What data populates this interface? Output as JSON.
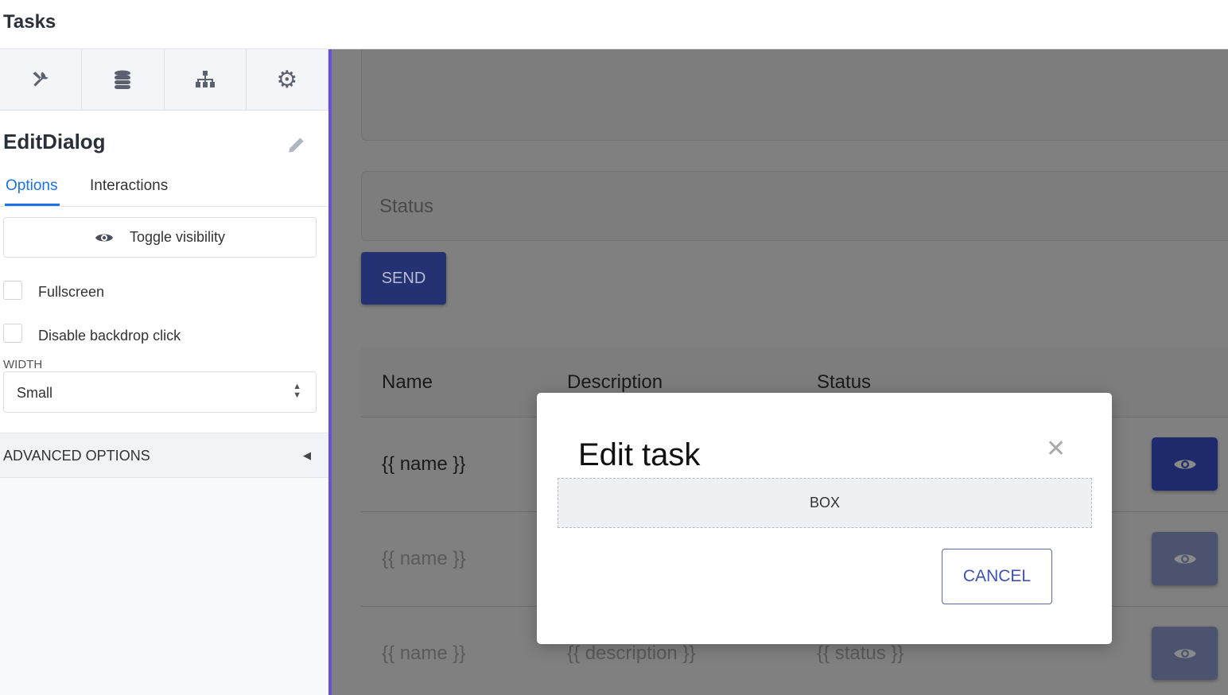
{
  "header": {
    "title": "Tasks"
  },
  "sidebar": {
    "toolbar": [
      {
        "icon": "tools-icon"
      },
      {
        "icon": "database-icon"
      },
      {
        "icon": "sitemap-icon"
      },
      {
        "icon": "gear-icon"
      }
    ],
    "component_name": "EditDialog",
    "tabs": [
      {
        "label": "Options",
        "active": true
      },
      {
        "label": "Interactions",
        "active": false
      }
    ],
    "toggle_visibility": "Toggle visibility",
    "fullscreen": {
      "label": "Fullscreen",
      "checked": false
    },
    "disable_backdrop": {
      "label": "Disable backdrop click",
      "checked": false
    },
    "width_label": "WIDTH",
    "width_value": "Small",
    "advanced": "ADVANCED OPTIONS"
  },
  "main": {
    "status_placeholder": "Status",
    "send": "SEND",
    "table": {
      "headers": [
        "Name",
        "Description",
        "Status"
      ],
      "rows": [
        {
          "name": "{{ name }}"
        },
        {
          "name": "{{ name }}"
        },
        {
          "name": "{{ name }}",
          "description": "{{ description }}",
          "status": "{{ status }}"
        }
      ]
    }
  },
  "modal": {
    "title": "Edit task",
    "box": "BOX",
    "cancel": "CANCEL"
  },
  "colors": {
    "accent": "#1a73e8",
    "primary": "#1e2a6b",
    "sidebar_border": "#6a4fd8"
  }
}
